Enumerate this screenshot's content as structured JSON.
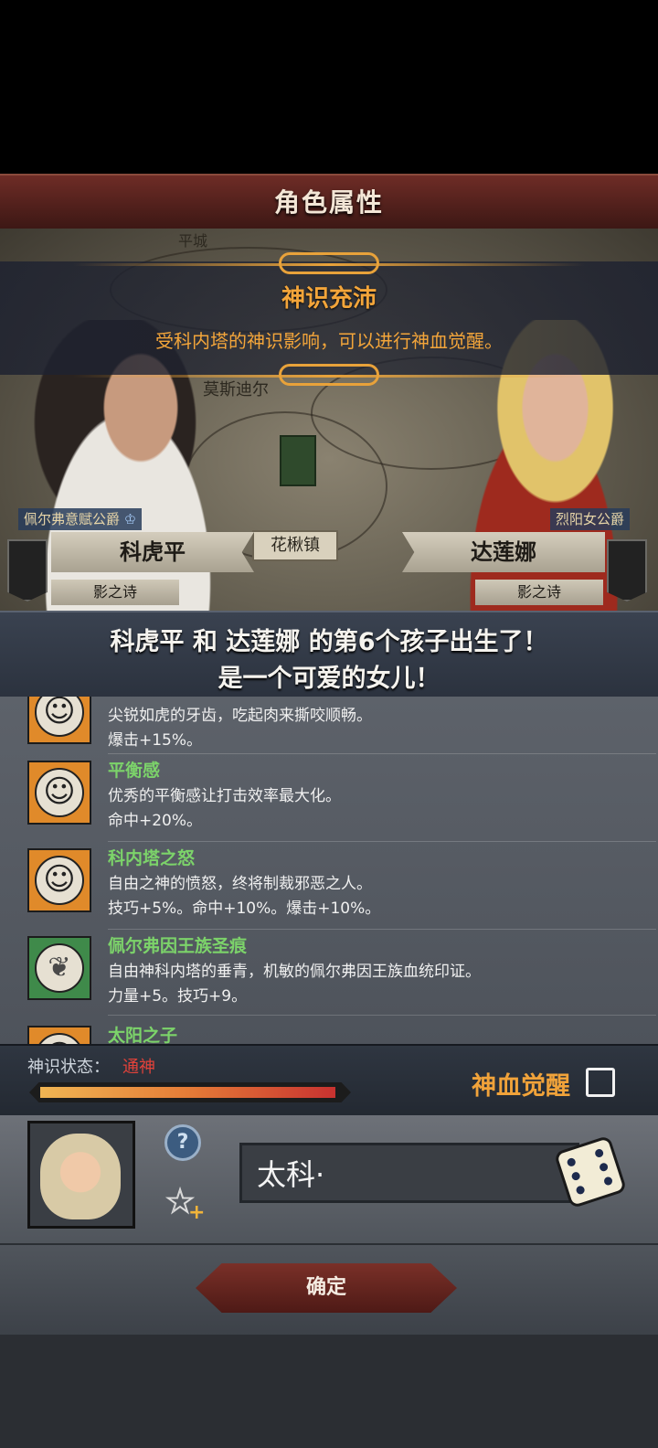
{
  "header": {
    "title": "角色属性"
  },
  "map": {
    "label_city_top": "平城",
    "label_city_mid": "莫斯迪尔",
    "town": "花楸镇"
  },
  "awakening": {
    "title": "神识充沛",
    "description": "受科内塔的神识影响，可以进行神血觉醒。"
  },
  "father": {
    "rank": "佩尔弗意赋公爵",
    "name": "科虎平",
    "house": "影之诗"
  },
  "mother": {
    "rank": "烈阳女公爵",
    "name": "达莲娜",
    "house": "影之诗"
  },
  "birth_message": {
    "line1": "科虎平 和 达莲娜 的第6个孩子出生了！",
    "line2": "是一个可爱的女儿！"
  },
  "traits": [
    {
      "name": "",
      "description": "尖锐如虎的牙齿，吃起肉来撕咬顺畅。",
      "effect": "爆击+15%。",
      "icon": "smile-sun-icon"
    },
    {
      "name": "平衡感",
      "description": "优秀的平衡感让打击效率最大化。",
      "effect": "命中+20%。",
      "icon": "smile-sun-icon"
    },
    {
      "name": "科内塔之怒",
      "description": "自由之神的愤怒，终将制裁邪恶之人。",
      "effect": "技巧+5%。命中+10%。爆击+10%。",
      "icon": "smile-sun-icon"
    },
    {
      "name": "佩尔弗因王族圣痕",
      "description": "自由神科内塔的垂青，机敏的佩尔弗因王族血统印证。",
      "effect": "力量+5。技巧+9。",
      "icon": "feather-icon"
    },
    {
      "name": "太阳之子",
      "description": "",
      "effect": "",
      "icon": "smile-sun-icon"
    }
  ],
  "status": {
    "label": "神识状态：",
    "value": "通神",
    "progress": 0.98
  },
  "awaken": {
    "label": "神血觉醒",
    "checked": false
  },
  "baby": {
    "name_value": "太科·"
  },
  "footer": {
    "confirm_label": "确定"
  },
  "colors": {
    "accent_orange": "#f1a33a",
    "trait_green": "#7cd36a",
    "status_red": "#e2423a"
  }
}
